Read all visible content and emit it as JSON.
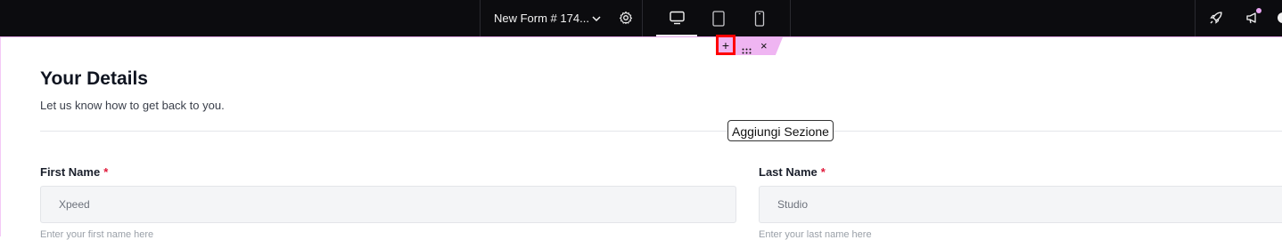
{
  "topbar": {
    "form_title": "New Form # 174...",
    "icons": {
      "chevron": "chevron-down-icon",
      "settings": "gear-icon",
      "desktop": "desktop-icon",
      "tablet": "tablet-icon",
      "mobile": "mobile-icon",
      "rocket": "rocket-icon",
      "announce": "megaphone-icon"
    },
    "active_device": "desktop"
  },
  "section_toolbar": {
    "add_label": "+",
    "close_label": "×",
    "accent": "#efb5f2",
    "highlight": "#ff0000"
  },
  "tooltip": {
    "text": "Aggiungi Sezione"
  },
  "form": {
    "heading": "Your Details",
    "subheading": "Let us know how to get back to you.",
    "fields": [
      {
        "label": "First Name",
        "required_mark": "*",
        "value": "Xpeed",
        "helper": "Enter your first name here"
      },
      {
        "label": "Last Name",
        "required_mark": "*",
        "value": "Studio",
        "helper": "Enter your last name here"
      }
    ]
  }
}
